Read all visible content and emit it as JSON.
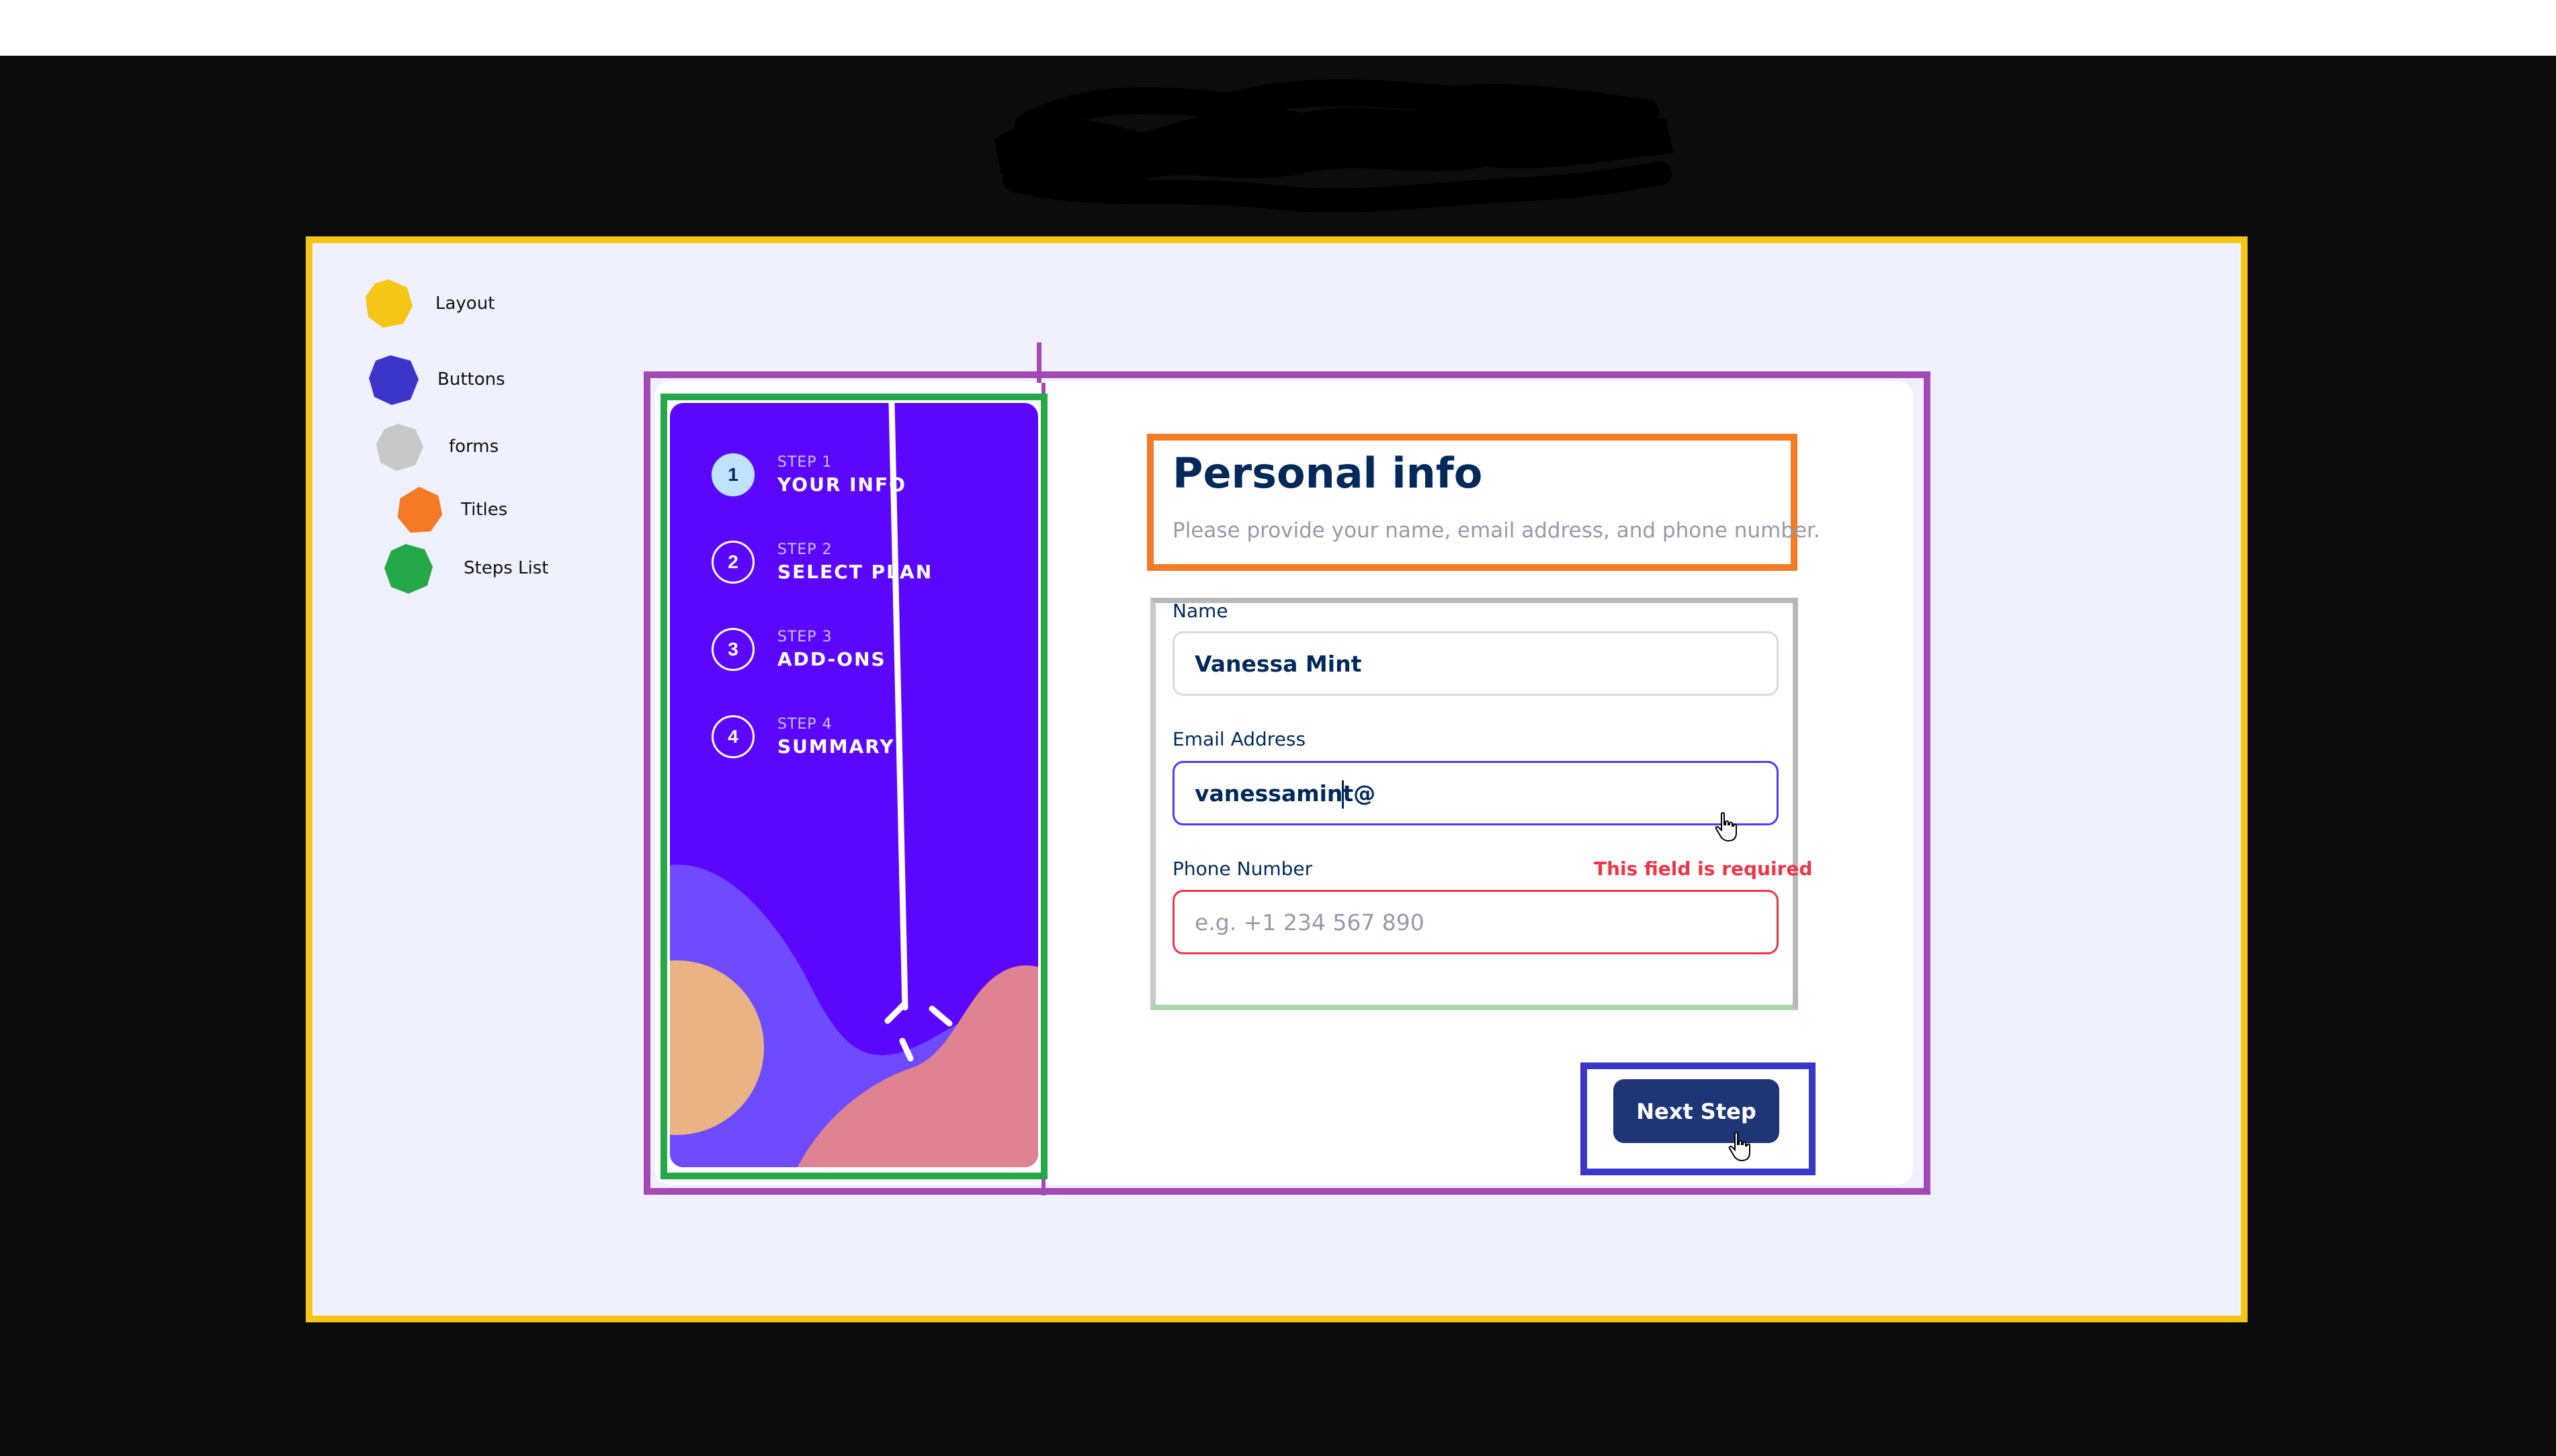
{
  "legend": {
    "items": [
      {
        "label": "Layout",
        "color": "#f5c518"
      },
      {
        "label": "Buttons",
        "color": "#3b35c9"
      },
      {
        "label": "forms",
        "color": "#c8c8c8"
      },
      {
        "label": "Titles",
        "color": "#f47a25"
      },
      {
        "label": "Steps List",
        "color": "#24a848"
      }
    ]
  },
  "sidebar": {
    "steps": [
      {
        "number": "1",
        "step_label": "STEP 1",
        "title": "YOUR INFO",
        "active": true
      },
      {
        "number": "2",
        "step_label": "STEP 2",
        "title": "SELECT PLAN",
        "active": false
      },
      {
        "number": "3",
        "step_label": "STEP 3",
        "title": "ADD-ONS",
        "active": false
      },
      {
        "number": "4",
        "step_label": "STEP 4",
        "title": "SUMMARY",
        "active": false
      }
    ]
  },
  "form": {
    "title": "Personal info",
    "subtitle": "Please provide your name, email address, and phone number.",
    "name": {
      "label": "Name",
      "value": "Vanessa Mint"
    },
    "email": {
      "label": "Email Address",
      "value": "vanessamint@"
    },
    "phone": {
      "label": "Phone Number",
      "placeholder": "e.g. +1 234 567 890",
      "error": "This field is required"
    }
  },
  "actions": {
    "next_label": "Next Step"
  },
  "colors": {
    "sidebar_bg": "#5c07fd",
    "primary_text": "#02295a",
    "button_bg": "#1f3676",
    "error": "#ed3548",
    "focus": "#473dff",
    "page_bg": "#eff1fe"
  }
}
